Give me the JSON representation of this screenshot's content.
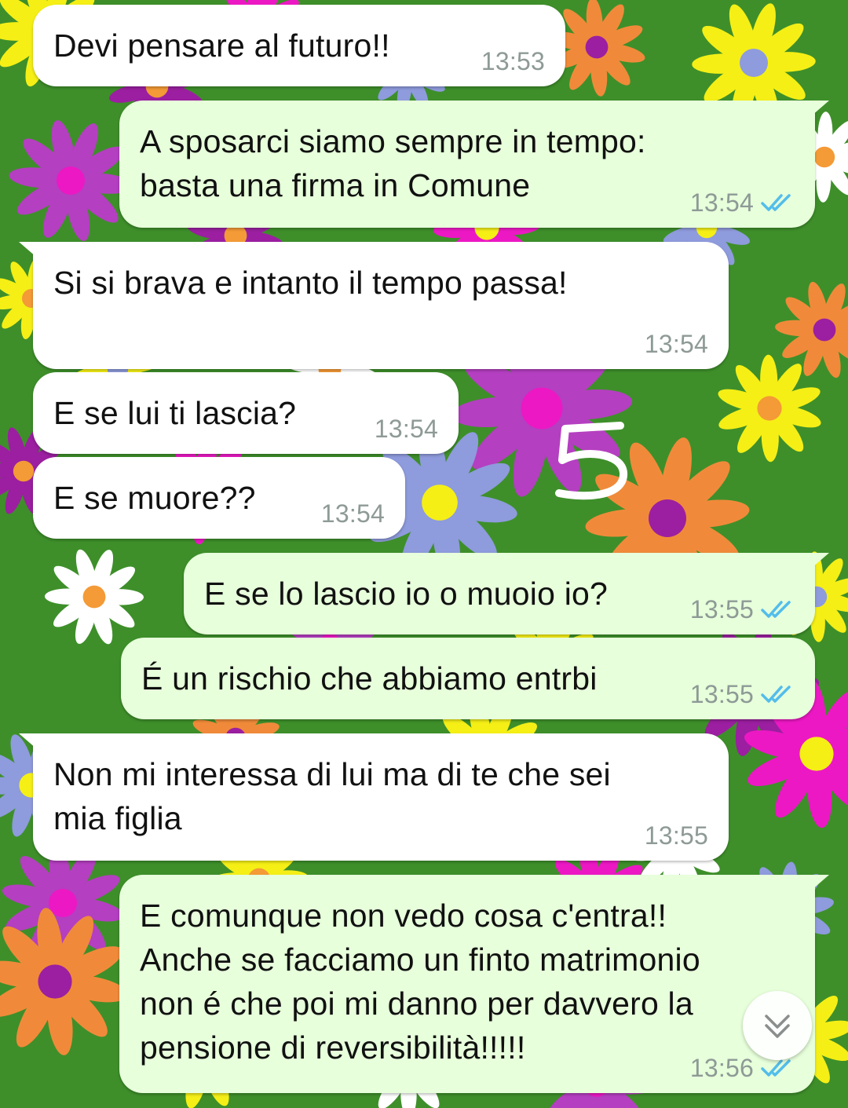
{
  "messages": [
    {
      "dir": "in",
      "text": "Devi pensare al futuro!!",
      "time": "13:53"
    },
    {
      "dir": "out",
      "text": "A sposarci siamo sempre in tempo:\nbasta una firma in Comune",
      "time": "13:54",
      "status": "read"
    },
    {
      "dir": "in",
      "text": "Si si brava e intanto il tempo passa!",
      "time": "13:54"
    },
    {
      "dir": "in",
      "text": "E se lui ti lascia?",
      "time": "13:54"
    },
    {
      "dir": "in",
      "text": "E se muore??",
      "time": "13:54"
    },
    {
      "dir": "out",
      "text": "E se lo lascio io o muoio io?",
      "time": "13:55",
      "status": "read"
    },
    {
      "dir": "out",
      "text": "É un rischio che abbiamo entrbi",
      "time": "13:55",
      "status": "read"
    },
    {
      "dir": "in",
      "text": "Non mi interessa di lui ma di te che sei\nmia figlia",
      "time": "13:55"
    },
    {
      "dir": "out",
      "text": "E comunque non vedo cosa c'entra!!\nAnche se facciamo un finto matrimonio\nnon é che poi mi danno per davvero la\npensione di reversibilità!!!!!",
      "time": "13:56",
      "status": "read"
    }
  ],
  "annotation": {
    "handwritten_number": "5"
  },
  "icons": {
    "read_receipt": "double-check-icon",
    "scroll_down": "chevron-double-down-icon"
  },
  "colors": {
    "incoming_bubble": "#ffffff",
    "outgoing_bubble": "#e7ffdb",
    "read_ticks": "#53bdeb",
    "timestamp": "#8e9a96",
    "wallpaper_green": "#3e8f2a"
  }
}
